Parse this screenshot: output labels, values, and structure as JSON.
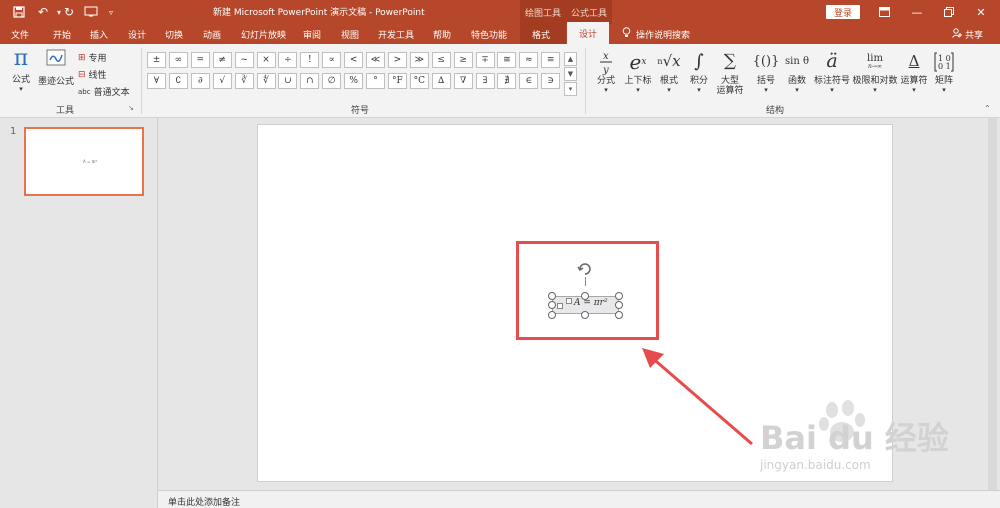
{
  "window": {
    "title": "新建 Microsoft PowerPoint 演示文稿 - PowerPoint",
    "context_group_draw": "绘图工具",
    "context_group_formula": "公式工具",
    "login_label": "登录"
  },
  "tabs": [
    {
      "label": "文件"
    },
    {
      "label": "开始"
    },
    {
      "label": "插入"
    },
    {
      "label": "设计"
    },
    {
      "label": "切换"
    },
    {
      "label": "动画"
    },
    {
      "label": "幻灯片放映"
    },
    {
      "label": "审阅"
    },
    {
      "label": "视图"
    },
    {
      "label": "开发工具"
    },
    {
      "label": "帮助"
    },
    {
      "label": "特色功能"
    },
    {
      "label": "格式"
    },
    {
      "label": "设计"
    }
  ],
  "tell_me": "操作说明搜索",
  "share_label": "共享",
  "ribbon": {
    "tools": {
      "formula": "公式",
      "ink": "墨迹公式",
      "professional": "专用",
      "linear": "线性",
      "abc": "abc",
      "plain_text": "普通文本",
      "group_label": "工具"
    },
    "symbols": {
      "row1": [
        "±",
        "∞",
        "=",
        "≠",
        "~",
        "×",
        "÷",
        "!",
        "∝",
        "<",
        "≪",
        ">",
        "≫",
        "≤",
        "≥",
        "∓",
        "≅",
        "≈",
        "≡"
      ],
      "row2": [
        "∀",
        "∁",
        "∂",
        "√",
        "∛",
        "∜",
        "∪",
        "∩",
        "∅",
        "%",
        "°",
        "°F",
        "°C",
        "∆",
        "∇",
        "∃",
        "∄",
        "∈",
        "∋"
      ],
      "group_label": "符号"
    },
    "structures": {
      "items": [
        {
          "icon": "x/y",
          "label": "分式"
        },
        {
          "icon": "eˣ",
          "label": "上下标"
        },
        {
          "icon": "ⁿ√x",
          "label": "根式"
        },
        {
          "icon": "∫",
          "label": "积分"
        },
        {
          "icon": "∑",
          "label": "大型\n运算符"
        },
        {
          "icon": "{()}",
          "label": "括号"
        },
        {
          "icon": "sinθ",
          "label": "函数"
        },
        {
          "icon": "ä",
          "label": "标注符号"
        },
        {
          "icon": "lim",
          "label": "极限和对数"
        },
        {
          "icon": "Δ",
          "label": "运算符"
        },
        {
          "icon": "[10/01]",
          "label": "矩阵"
        }
      ],
      "group_label": "结构"
    }
  },
  "slide_panel": {
    "slide_number": "1"
  },
  "slide": {
    "equation": "A = πr²"
  },
  "notes_placeholder": "单击此处添加备注",
  "watermark": {
    "main": "Bai du 经验",
    "sub": "jingyan.baidu.com"
  },
  "colors": {
    "accent": "#b7472a",
    "highlight": "#e84b4b",
    "thumb_border": "#e8734d"
  }
}
